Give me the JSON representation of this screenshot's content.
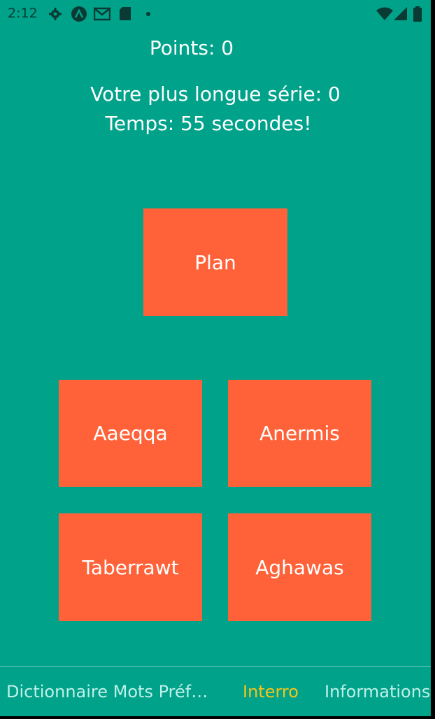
{
  "status_bar": {
    "time": "2:12",
    "icons_left": [
      "settings-icon",
      "android-debug-icon",
      "gmail-icon",
      "sd-card-icon",
      "dot-icon"
    ],
    "icons_right": [
      "wifi-icon",
      "cell-signal-icon",
      "battery-icon"
    ]
  },
  "game": {
    "points": "Points: 0",
    "streak": "Votre plus longue série: 0",
    "timer": "Temps: 55 secondes!",
    "question": "Plan",
    "answers": [
      "Aaeqqa",
      "Anermis",
      "Taberrawt",
      "Aghawas"
    ]
  },
  "bottom_nav": {
    "items": [
      {
        "label": "Dictionnaire Mots Préféré…"
      },
      {
        "label": "Interro",
        "active": true
      },
      {
        "label": "Informations"
      }
    ]
  },
  "colors": {
    "background": "#00A28A",
    "tile": "#FF6239",
    "active_tab": "#F5C518",
    "inactive_tab": "#BFF0E8"
  }
}
